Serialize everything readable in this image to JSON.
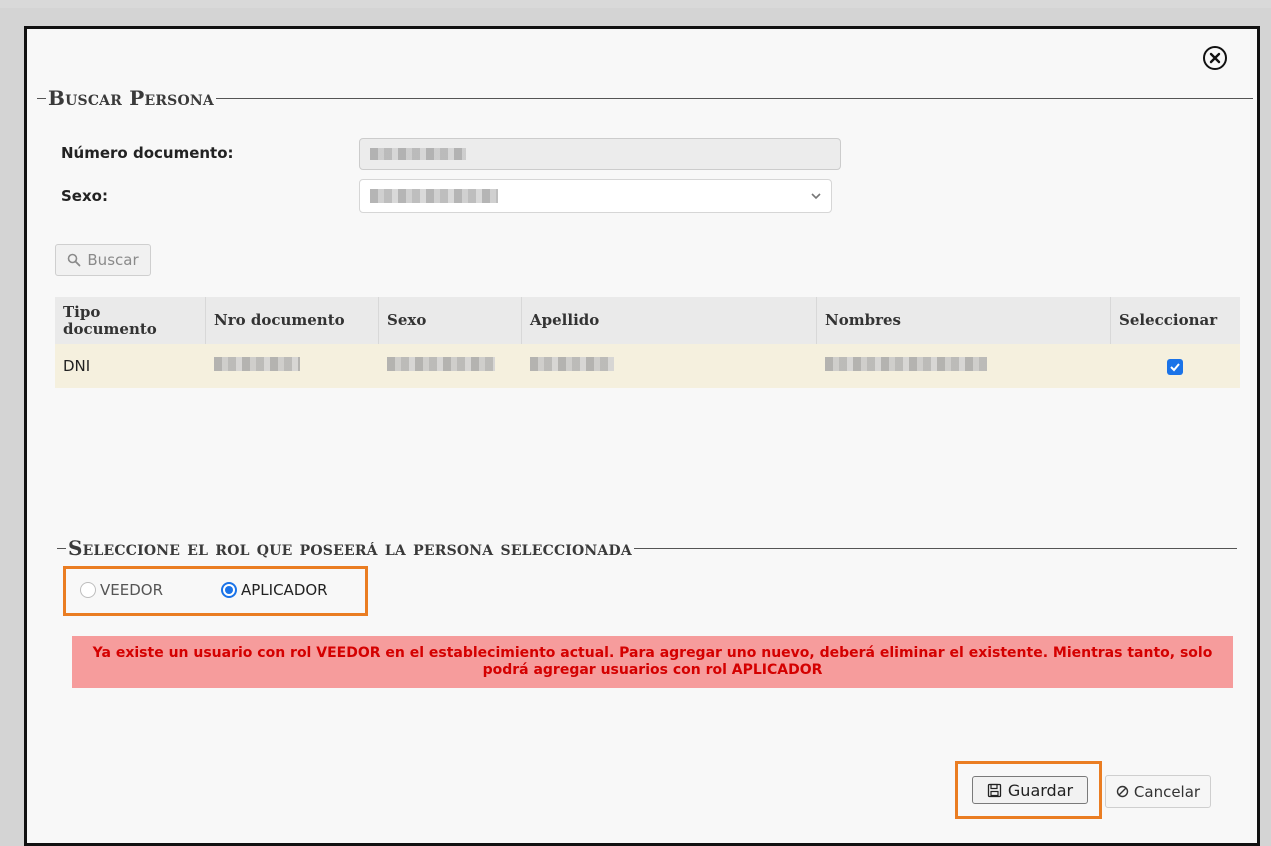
{
  "modal": {
    "search_section": {
      "title": "Buscar Persona",
      "doc_number_label": "Número documento:",
      "doc_number_value": "",
      "sex_label": "Sexo:",
      "sex_value": "",
      "search_button": "Buscar"
    },
    "results_table": {
      "columns": [
        "Tipo documento",
        "Nro documento",
        "Sexo",
        "Apellido",
        "Nombres",
        "Seleccionar"
      ],
      "rows": [
        {
          "tipo": "DNI",
          "nro": "",
          "sexo": "",
          "apellido": "",
          "nombres": "",
          "selected": true
        }
      ]
    },
    "role_section": {
      "title": "Seleccione el rol que poseerá la persona seleccionada",
      "options": [
        {
          "label": "VEEDOR",
          "checked": false,
          "disabled": true
        },
        {
          "label": "APLICADOR",
          "checked": true,
          "disabled": false
        }
      ]
    },
    "alert_message": "Ya existe un usuario con rol VEEDOR en el establecimiento actual. Para agregar uno nuevo, deberá eliminar el existente. Mientras tanto, solo podrá agregar usuarios con rol APLICADOR",
    "buttons": {
      "save": "Guardar",
      "cancel": "Cancelar"
    }
  },
  "icons": {
    "close": "close-circle-icon",
    "search": "search-icon",
    "chevron": "chevron-down-icon",
    "save": "floppy-disk-icon",
    "cancel": "cancel-icon",
    "check": "checkmark-icon"
  },
  "colors": {
    "alert_bg": "#f69c9c",
    "alert_text": "#d40000",
    "highlight_frame": "#ea7d22",
    "accent": "#1a73e8",
    "row_bg": "#f5f0de"
  }
}
